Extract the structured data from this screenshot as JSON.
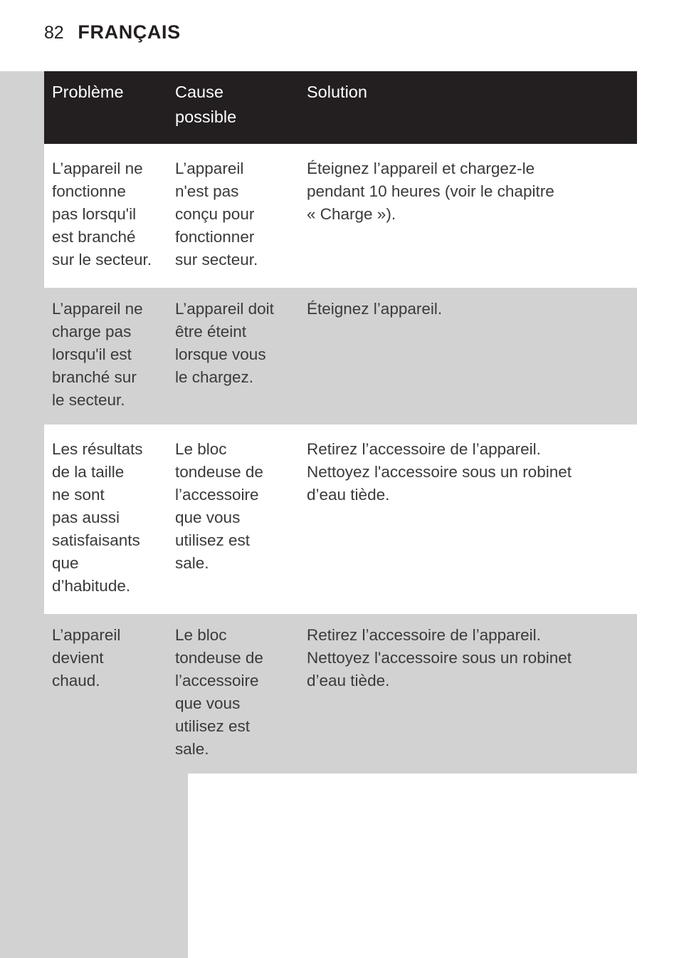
{
  "page": {
    "folio": "82",
    "section_title": "FRANÇAIS",
    "background_color": "#ffffff",
    "margin_band_color": "#d2d2d2",
    "text_color": "#3a3a3a",
    "header_background_color": "#231f20",
    "header_text_color": "#ffffff",
    "shaded_row_color": "#d2d2d2"
  },
  "table": {
    "headers": {
      "problem": "Problème",
      "cause": "Cause\npossible",
      "solution": "Solution"
    },
    "rows": [
      {
        "problem": "L’appareil ne\nfonctionne\npas lorsqu'il\nest branché\nsur le secteur.",
        "cause": "L’appareil\nn'est pas\nconçu pour\nfonctionner\nsur secteur.",
        "solution": "Éteignez l’appareil et chargez-le\npendant 10 heures (voir le chapitre\n« Charge »).",
        "shaded": false
      },
      {
        "problem": "L’appareil ne\ncharge pas\nlorsqu'il est\nbranché sur\nle secteur.",
        "cause": "L’appareil doit\nêtre éteint\nlorsque vous\nle chargez.",
        "solution": "Éteignez l’appareil.",
        "shaded": true
      },
      {
        "problem": "Les résultats\nde la taille\nne sont\npas aussi\nsatisfaisants\nque\nd’habitude.",
        "cause": "Le bloc\ntondeuse de\nl’accessoire\nque vous\nutilisez est\nsale.",
        "solution": "Retirez l’accessoire de l’appareil.\nNettoyez l'accessoire sous un robinet\nd’eau tiède.",
        "shaded": false
      },
      {
        "problem": "L’appareil\ndevient\nchaud.",
        "cause": "Le bloc\ntondeuse de\nl’accessoire\nque vous\nutilisez est\nsale.",
        "solution": "Retirez l’accessoire de l’appareil.\nNettoyez l'accessoire sous un robinet\nd’eau tiède.",
        "shaded": true
      }
    ]
  }
}
